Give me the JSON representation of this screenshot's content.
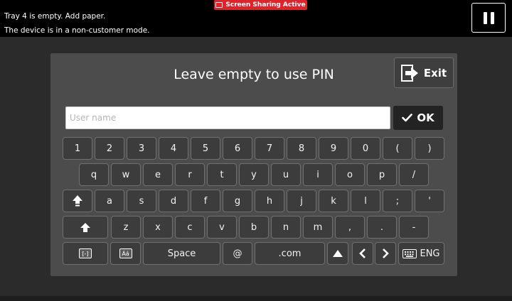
{
  "status": {
    "line1": "Tray 4 is empty.  Add paper.",
    "line2": "The device is in a non-customer mode."
  },
  "badge": {
    "label": "Screen Sharing Active"
  },
  "login": {
    "title": "Leave empty to use PIN",
    "exit_label": "Exit",
    "username_placeholder": "User name",
    "username_value": "",
    "ok_label": "OK"
  },
  "keyboard": {
    "row1": [
      "1",
      "2",
      "3",
      "4",
      "5",
      "6",
      "7",
      "8",
      "9",
      "0",
      "(",
      ")"
    ],
    "row2": [
      "q",
      "w",
      "e",
      "r",
      "t",
      "y",
      "u",
      "i",
      "o",
      "p",
      "/"
    ],
    "row3": [
      "a",
      "s",
      "d",
      "f",
      "g",
      "h",
      "j",
      "k",
      "l",
      ";",
      "'"
    ],
    "row4": [
      "z",
      "x",
      "c",
      "v",
      "b",
      "n",
      "m",
      ",",
      ".",
      "-"
    ],
    "space_label": "Space",
    "at_label": "@",
    "dotcom_label": ".com",
    "lang_label": "ENG",
    "special_label": "[-]",
    "accent_label": "Áá"
  },
  "colors": {
    "badge_red": "#e0232b",
    "panel": "#4c4c4c",
    "key": "#3c3c3c"
  }
}
